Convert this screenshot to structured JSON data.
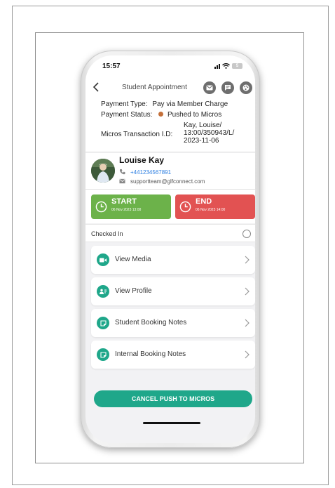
{
  "status_bar": {
    "time": "15:57",
    "battery": "5"
  },
  "nav": {
    "title": "Student Appointment",
    "actions": [
      "mail-icon",
      "message-icon",
      "palette-icon"
    ]
  },
  "payment": {
    "type_label": "Payment Type:",
    "type_value": "Pay via Member Charge",
    "status_label": "Payment Status:",
    "status_value": "Pushed to Micros",
    "status_color": "#c4703a",
    "tx_label": "Micros Transaction I.D:",
    "tx_value_line1": "Kay, Louise/",
    "tx_value_line2": "13:00/350943/L/",
    "tx_value_line3": "2023-11-06"
  },
  "student": {
    "name": "Louise Kay",
    "phone": "+441234567891",
    "email": "supportteam@glfconnect.com"
  },
  "timer": {
    "start_label": "START",
    "start_time": "06 Nov 2023 13:00",
    "end_label": "END",
    "end_time": "06 Nov 2023 14:00",
    "start_color": "#6cb24a",
    "end_color": "#e25252"
  },
  "checked_in": {
    "label": "Checked In",
    "checked": false
  },
  "menu": [
    {
      "label": "View Media",
      "icon": "video-icon"
    },
    {
      "label": "View Profile",
      "icon": "profile-icon"
    },
    {
      "label": "Student Booking Notes",
      "icon": "note-icon"
    },
    {
      "label": "Internal Booking Notes",
      "icon": "note-icon"
    }
  ],
  "cancel_button": "CANCEL PUSH TO MICROS",
  "colors": {
    "accent": "#1fa78a",
    "background": "#f2f2f4"
  }
}
